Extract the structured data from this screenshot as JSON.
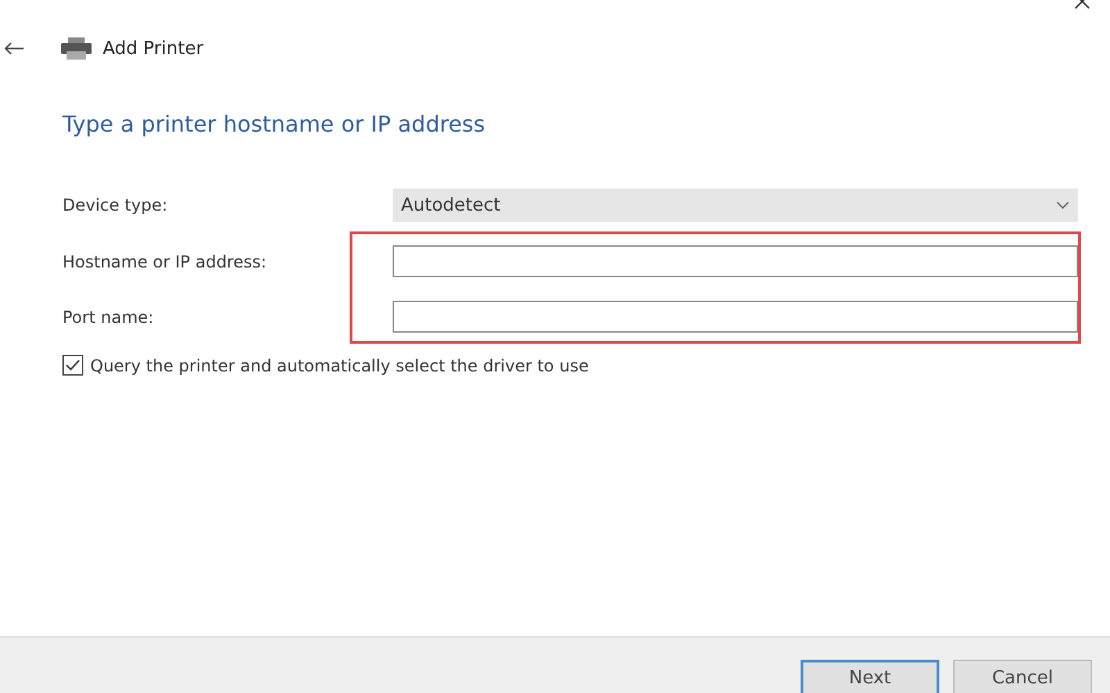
{
  "window": {
    "title": "Add Printer"
  },
  "heading": "Type a printer hostname or IP address",
  "fields": [
    {
      "kind": "dropdown",
      "label": "Device type:",
      "value": "Autodetect",
      "highlighted": false
    },
    {
      "kind": "text",
      "label": "Hostname or IP address:",
      "highlighted": true
    },
    {
      "kind": "text",
      "label": "Port name:",
      "highlighted": true
    }
  ],
  "query_option": {
    "label": "Query the printer and automatically select the driver to use",
    "checked": true
  },
  "buttons": [
    {
      "label": "Next",
      "default": true
    },
    {
      "label": "Cancel",
      "default": false
    }
  ]
}
